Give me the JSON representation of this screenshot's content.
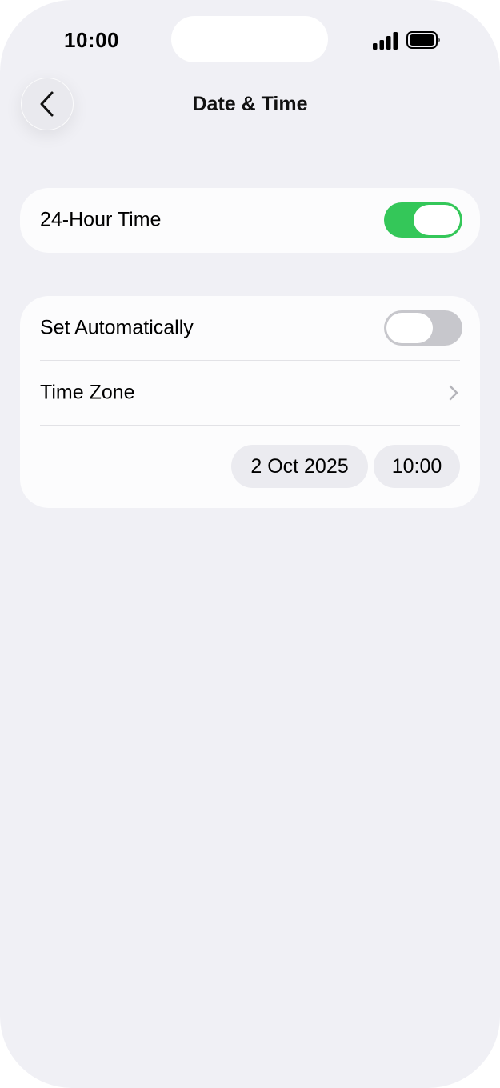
{
  "status_bar": {
    "time": "10:00",
    "signal_icon": "cellular-signal-icon",
    "battery_icon": "battery-full-icon"
  },
  "nav": {
    "back_icon": "chevron-left-icon",
    "title": "Date & Time"
  },
  "settings": {
    "twenty_four_hour": {
      "label": "24-Hour Time",
      "enabled": true
    },
    "set_automatically": {
      "label": "Set Automatically",
      "enabled": false
    },
    "time_zone": {
      "label": "Time Zone",
      "icon": "chevron-right-icon"
    },
    "date_value": "2 Oct 2025",
    "time_value": "10:00"
  },
  "colors": {
    "background": "#f0f0f5",
    "card": "#fcfcfd",
    "toggle_on": "#34c759",
    "toggle_off": "#c7c7cc",
    "pill": "#ebebf0"
  }
}
